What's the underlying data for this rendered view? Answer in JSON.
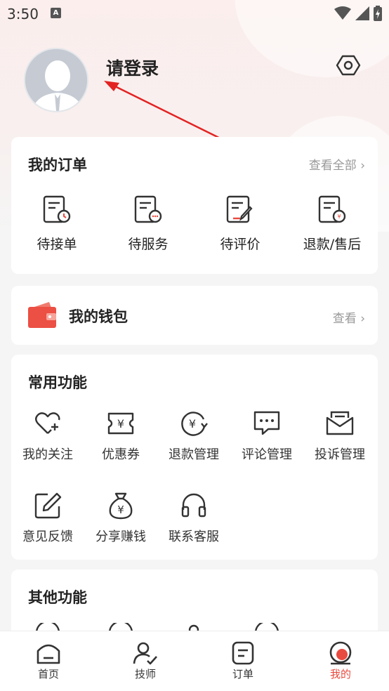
{
  "status": {
    "time": "3:50",
    "a_badge": "A"
  },
  "profile": {
    "login_text": "请登录"
  },
  "orders": {
    "title": "我的订单",
    "view_all": "查看全部 ›",
    "items": [
      {
        "label": "待接单",
        "icon": "pending-accept-icon"
      },
      {
        "label": "待服务",
        "icon": "pending-service-icon"
      },
      {
        "label": "待评价",
        "icon": "pending-review-icon"
      },
      {
        "label": "退款/售后",
        "icon": "refund-aftersale-icon"
      }
    ]
  },
  "wallet": {
    "title": "我的钱包",
    "view": "查看 ›"
  },
  "common": {
    "title": "常用功能",
    "items": [
      {
        "label": "我的关注",
        "icon": "heart-plus-icon"
      },
      {
        "label": "优惠券",
        "icon": "coupon-icon"
      },
      {
        "label": "退款管理",
        "icon": "refund-icon"
      },
      {
        "label": "评论管理",
        "icon": "comment-icon"
      },
      {
        "label": "投诉管理",
        "icon": "complaint-icon"
      },
      {
        "label": "意见反馈",
        "icon": "feedback-icon"
      },
      {
        "label": "分享赚钱",
        "icon": "money-bag-icon"
      },
      {
        "label": "联系客服",
        "icon": "headset-icon"
      }
    ]
  },
  "other": {
    "title": "其他功能"
  },
  "tabbar": {
    "items": [
      {
        "label": "首页",
        "icon": "home-icon"
      },
      {
        "label": "技师",
        "icon": "technician-icon"
      },
      {
        "label": "订单",
        "icon": "order-icon"
      },
      {
        "label": "我的",
        "icon": "mine-icon",
        "active": true
      }
    ]
  },
  "colors": {
    "accent": "#e84a3f",
    "background": "#f5f5f5"
  }
}
